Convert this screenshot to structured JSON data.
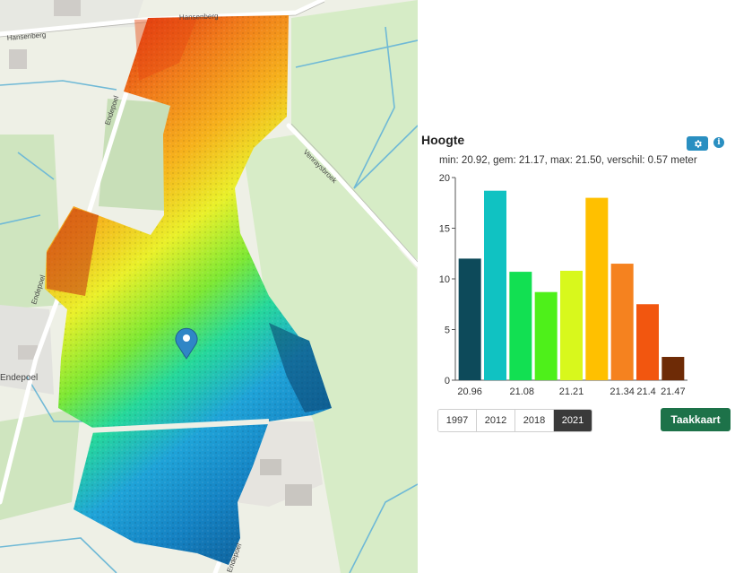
{
  "map": {
    "street_labels": [
      "Hansenberg",
      "Hansenberg",
      "Endepoel",
      "Endepoel",
      "Venraysbroek",
      "Endepoel",
      "Endepoel"
    ]
  },
  "panel": {
    "title": "Hoogte",
    "stats": "min: 20.92, gem: 21.17, max: 21.50, verschil: 0.57 meter",
    "icons": {
      "settings": "gear-icon",
      "info": "info-icon"
    },
    "info_glyph": "i",
    "years": [
      "1997",
      "2012",
      "2018",
      "2021"
    ],
    "active_year": "2021",
    "taakkaart_label": "Taakkaart"
  },
  "chart_data": {
    "type": "bar",
    "title": "",
    "xlabel": "",
    "ylabel": "",
    "ylim": [
      0,
      20
    ],
    "yticks": [
      0,
      5,
      10,
      15,
      20
    ],
    "xtick_labels": [
      "20.96",
      "21.08",
      "21.21",
      "21.34",
      "21.4",
      "21.47"
    ],
    "values": [
      12,
      18.7,
      10.7,
      8.7,
      10.8,
      18,
      11.5,
      7.5,
      2.3
    ],
    "colors": [
      "#0d4a5a",
      "#10c2c2",
      "#12e052",
      "#4ef01a",
      "#d8f81c",
      "#ffc000",
      "#f5821f",
      "#f2560f",
      "#6e2b06"
    ],
    "grid": false
  }
}
